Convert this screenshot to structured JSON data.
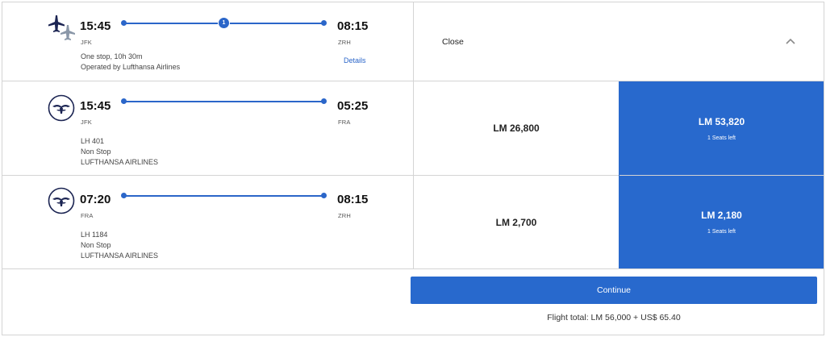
{
  "summary": {
    "dep_time": "15:45",
    "dep_code": "JFK",
    "arr_time": "08:15",
    "arr_code": "ZRH",
    "stops_count": "1",
    "duration": "One stop, 10h 30m",
    "operator": "Operated by Lufthansa Airlines",
    "details_label": "Details",
    "close_label": "Close"
  },
  "segments": [
    {
      "dep_time": "15:45",
      "dep_code": "JFK",
      "arr_time": "05:25",
      "arr_code": "FRA",
      "flight": "LH 401",
      "stops": "Non Stop",
      "airline": "LUFTHANSA AIRLINES",
      "price_main": "LM 26,800",
      "price_selected": "LM 53,820",
      "seats_left": "1 Seats left"
    },
    {
      "dep_time": "07:20",
      "dep_code": "FRA",
      "arr_time": "08:15",
      "arr_code": "ZRH",
      "flight": "LH 1184",
      "stops": "Non Stop",
      "airline": "LUFTHANSA AIRLINES",
      "price_main": "LM 2,700",
      "price_selected": "LM 2,180",
      "seats_left": "1 Seats left"
    }
  ],
  "footer": {
    "continue_label": "Continue",
    "flight_total": "Flight total: LM 56,000 + US$ 65.40"
  },
  "colors": {
    "accent": "#2869cd",
    "route": "#2b66c9",
    "logo_navy": "#1c2553"
  }
}
